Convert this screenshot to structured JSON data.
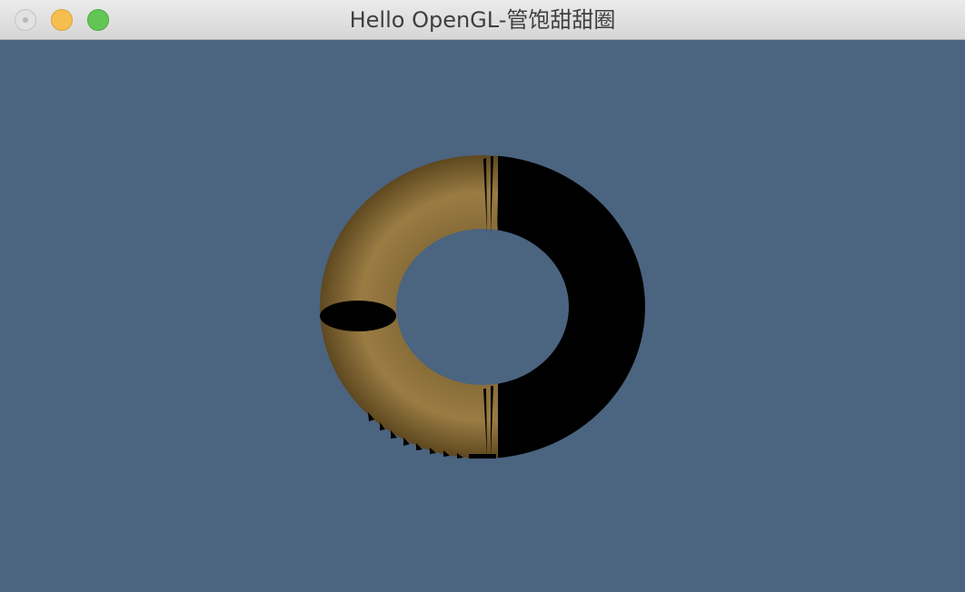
{
  "window": {
    "title": "Hello OpenGL-管饱甜甜圈",
    "buttons": {
      "close": "close-button",
      "minimize": "minimize-button",
      "zoom": "zoom-button"
    }
  },
  "scene": {
    "background_color": "#4b6480",
    "torus_color": "#8b6f3a",
    "shadow_color": "#000000"
  }
}
